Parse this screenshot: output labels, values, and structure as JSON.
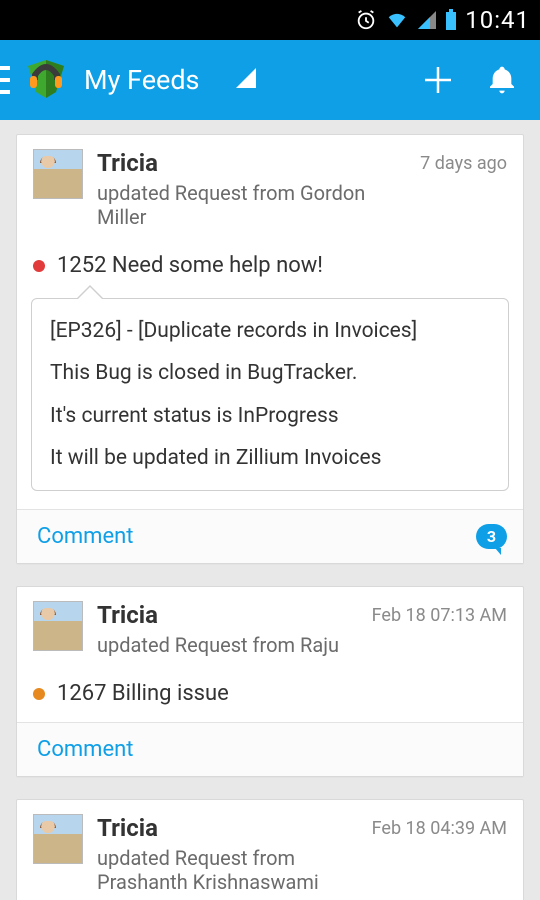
{
  "colors": {
    "primary": "#0e9fe7",
    "status_open": "#e23b3b",
    "status_progress": "#e68a1f"
  },
  "statusbar": {
    "time": "10:41"
  },
  "appbar": {
    "title": "My Feeds"
  },
  "feed": [
    {
      "author": "Tricia",
      "subtitle": "updated Request from Gordon Miller",
      "time": "7 days ago",
      "status_color": "#e23b3b",
      "subject": "1252 Need some help now!",
      "body_lines": [
        "[EP326] - [Duplicate records in Invoices]",
        "This Bug is closed in BugTracker.",
        "It's current status is InProgress",
        "It will be updated in Zillium Invoices"
      ],
      "comment_label": "Comment",
      "comment_count": "3"
    },
    {
      "author": "Tricia",
      "subtitle": "updated Request from Raju",
      "time": "Feb 18 07:13 AM",
      "status_color": "#e68a1f",
      "subject": "1267 Billing issue",
      "body_lines": [],
      "comment_label": "Comment",
      "comment_count": ""
    },
    {
      "author": "Tricia",
      "subtitle": "updated Request from Prashanth Krishnaswami",
      "time": "Feb 18 04:39 AM",
      "status_color": "",
      "subject": "",
      "body_lines": [],
      "comment_label": "",
      "comment_count": ""
    }
  ]
}
